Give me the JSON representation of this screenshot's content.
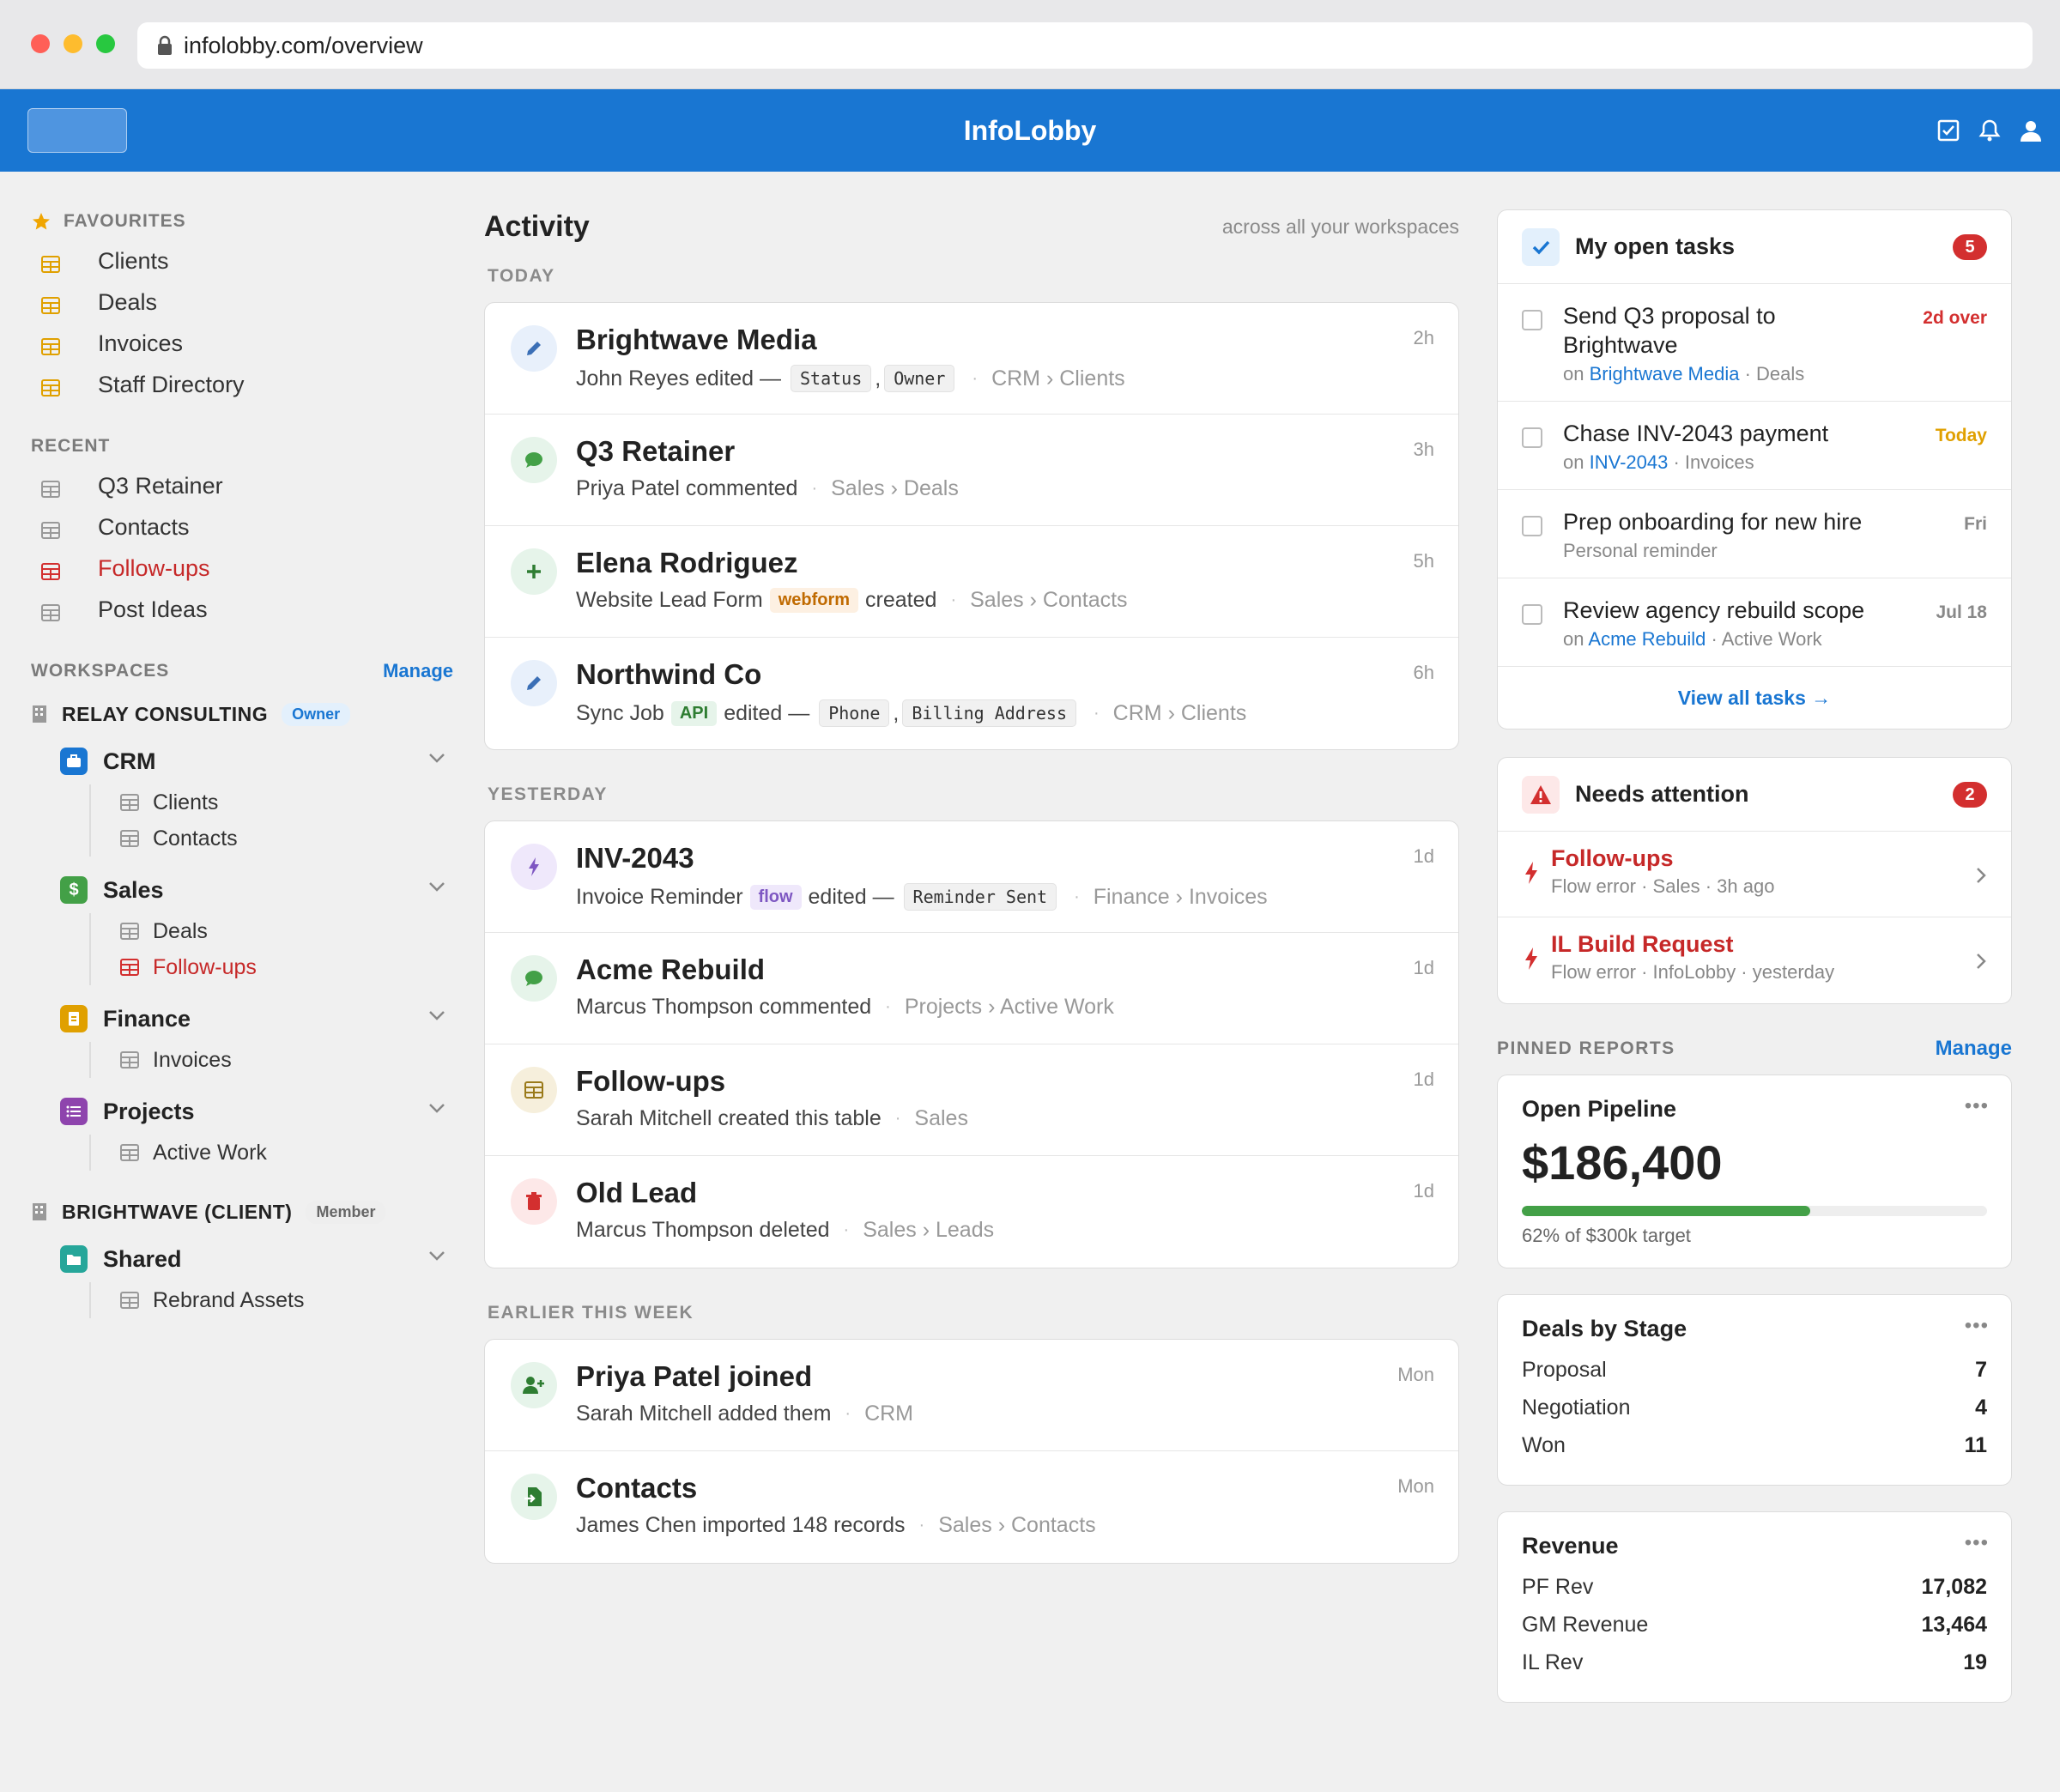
{
  "browser": {
    "url": "infolobby.com/overview"
  },
  "app": {
    "brand": "InfoLobby"
  },
  "sidebar": {
    "favourites_label": "FAVOURITES",
    "favourites": [
      "Clients",
      "Deals",
      "Invoices",
      "Staff Directory"
    ],
    "recent_label": "RECENT",
    "recent": [
      "Q3 Retainer",
      "Contacts",
      "Follow-ups",
      "Post Ideas"
    ],
    "workspaces_label": "WORKSPACES",
    "manage": "Manage",
    "ws1": {
      "name": "RELAY CONSULTING",
      "role": "Owner"
    },
    "crm": {
      "name": "CRM",
      "items": [
        "Clients",
        "Contacts"
      ]
    },
    "sales": {
      "name": "Sales",
      "items": [
        "Deals",
        "Follow-ups"
      ]
    },
    "finance": {
      "name": "Finance",
      "items": [
        "Invoices"
      ]
    },
    "projects": {
      "name": "Projects",
      "items": [
        "Active Work"
      ]
    },
    "ws2": {
      "name": "BRIGHTWAVE (CLIENT)",
      "role": "Member"
    },
    "shared": {
      "name": "Shared",
      "items": [
        "Rebrand Assets"
      ]
    }
  },
  "activity": {
    "title": "Activity",
    "subtitle": "across all your workspaces",
    "today": "TODAY",
    "yesterday": "YESTERDAY",
    "earlier": "EARLIER THIS WEEK",
    "a1": {
      "title": "Brightwave Media",
      "time": "2h",
      "who": "John Reyes edited —",
      "f1": "Status",
      "comma": ",",
      "f2": "Owner",
      "p1": "CRM",
      "p2": "Clients"
    },
    "a2": {
      "title": "Q3 Retainer",
      "time": "3h",
      "who": "Priya Patel commented",
      "p1": "Sales",
      "p2": "Deals"
    },
    "a3": {
      "title": "Elena Rodriguez",
      "time": "5h",
      "who": "Website Lead Form",
      "pill": "webform",
      "act": "created",
      "p1": "Sales",
      "p2": "Contacts"
    },
    "a4": {
      "title": "Northwind Co",
      "time": "6h",
      "who": "Sync Job",
      "pill": "API",
      "act": "edited —",
      "f1": "Phone",
      "comma": ",",
      "f2": "Billing Address",
      "p1": "CRM",
      "p2": "Clients"
    },
    "a5": {
      "title": "INV-2043",
      "time": "1d",
      "who": "Invoice Reminder",
      "pill": "flow",
      "act": "edited —",
      "f1": "Reminder Sent",
      "p1": "Finance",
      "p2": "Invoices"
    },
    "a6": {
      "title": "Acme Rebuild",
      "time": "1d",
      "who": "Marcus Thompson commented",
      "p1": "Projects",
      "p2": "Active Work"
    },
    "a7": {
      "title": "Follow-ups",
      "time": "1d",
      "who": "Sarah Mitchell created this table",
      "p1": "Sales"
    },
    "a8": {
      "title": "Old Lead",
      "time": "1d",
      "who": "Marcus Thompson deleted",
      "p1": "Sales",
      "p2": "Leads"
    },
    "a9": {
      "title": "Priya Patel joined",
      "time": "Mon",
      "who": "Sarah Mitchell added them",
      "p1": "CRM"
    },
    "a10": {
      "title": "Contacts",
      "time": "Mon",
      "who": "James Chen imported 148 records",
      "p1": "Sales",
      "p2": "Contacts"
    }
  },
  "tasks": {
    "title": "My open tasks",
    "count": "5",
    "on": "on",
    "t1": {
      "title": "Send Q3 proposal to Brightwave",
      "link": "Brightwave Media",
      "ctx": "· Deals",
      "due": "2d over"
    },
    "t2": {
      "title": "Chase INV-2043 payment",
      "link": "INV-2043",
      "ctx": "· Invoices",
      "due": "Today"
    },
    "t3": {
      "title": "Prep onboarding for new hire",
      "sub": "Personal reminder",
      "due": "Fri"
    },
    "t4": {
      "title": "Review agency rebuild scope",
      "link": "Acme Rebuild",
      "ctx": "· Active Work",
      "due": "Jul 18"
    },
    "view_all": "View all tasks"
  },
  "attention": {
    "title": "Needs attention",
    "count": "2",
    "i1": {
      "title": "Follow-ups",
      "sub": "Flow error · Sales · 3h ago"
    },
    "i2": {
      "title": "IL Build Request",
      "sub": "Flow error · InfoLobby · yesterday"
    }
  },
  "reports": {
    "label": "PINNED REPORTS",
    "manage": "Manage",
    "pipeline": {
      "title": "Open Pipeline",
      "value": "$186,400",
      "progress": 0.62,
      "caption": "62% of $300k target"
    },
    "stages": {
      "title": "Deals by Stage",
      "rows": [
        [
          "Proposal",
          "7"
        ],
        [
          "Negotiation",
          "4"
        ],
        [
          "Won",
          "11"
        ]
      ]
    },
    "revenue": {
      "title": "Revenue",
      "rows": [
        [
          "PF Rev",
          "17,082"
        ],
        [
          "GM Revenue",
          "13,464"
        ],
        [
          "IL Rev",
          "19"
        ]
      ]
    }
  },
  "colors": {
    "brand": "#1976d2",
    "danger": "#d32f2f",
    "warning": "#e0a000",
    "success": "#43a047"
  }
}
